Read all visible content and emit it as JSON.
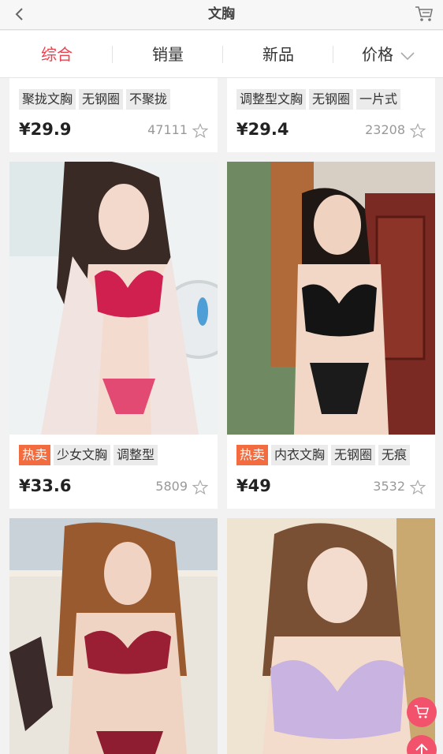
{
  "header": {
    "title": "文胸",
    "back_icon": "chevron-left-icon",
    "cart_icon": "cart-icon"
  },
  "tabs": [
    {
      "label": "综合",
      "active": true
    },
    {
      "label": "销量"
    },
    {
      "label": "新品"
    },
    {
      "label": "价格",
      "icon": "chevron-down-icon"
    }
  ],
  "products": [
    {
      "tags": [
        "聚拢文胸",
        "无钢圈",
        "不聚拢"
      ],
      "price": "¥29.9",
      "sales": "47111"
    },
    {
      "tags": [
        "调整型文胸",
        "无钢圈",
        "一片式"
      ],
      "price": "¥29.4",
      "sales": "23208"
    },
    {
      "hot": "热卖",
      "tags": [
        "少女文胸",
        "调整型"
      ],
      "price": "¥33.6",
      "sales": "5809"
    },
    {
      "hot": "热卖",
      "tags": [
        "内衣文胸",
        "无钢圈",
        "无痕"
      ],
      "price": "¥49",
      "sales": "3532"
    },
    {
      "tags": [],
      "price": "",
      "sales": ""
    },
    {
      "tags": [],
      "price": "",
      "sales": ""
    }
  ],
  "floating": {
    "cart_icon": "cart-icon",
    "top_icon": "arrow-up-icon"
  },
  "colors": {
    "accent": "#e8434f",
    "hot_tag": "#f36c3f",
    "fab": "#f2526b"
  }
}
